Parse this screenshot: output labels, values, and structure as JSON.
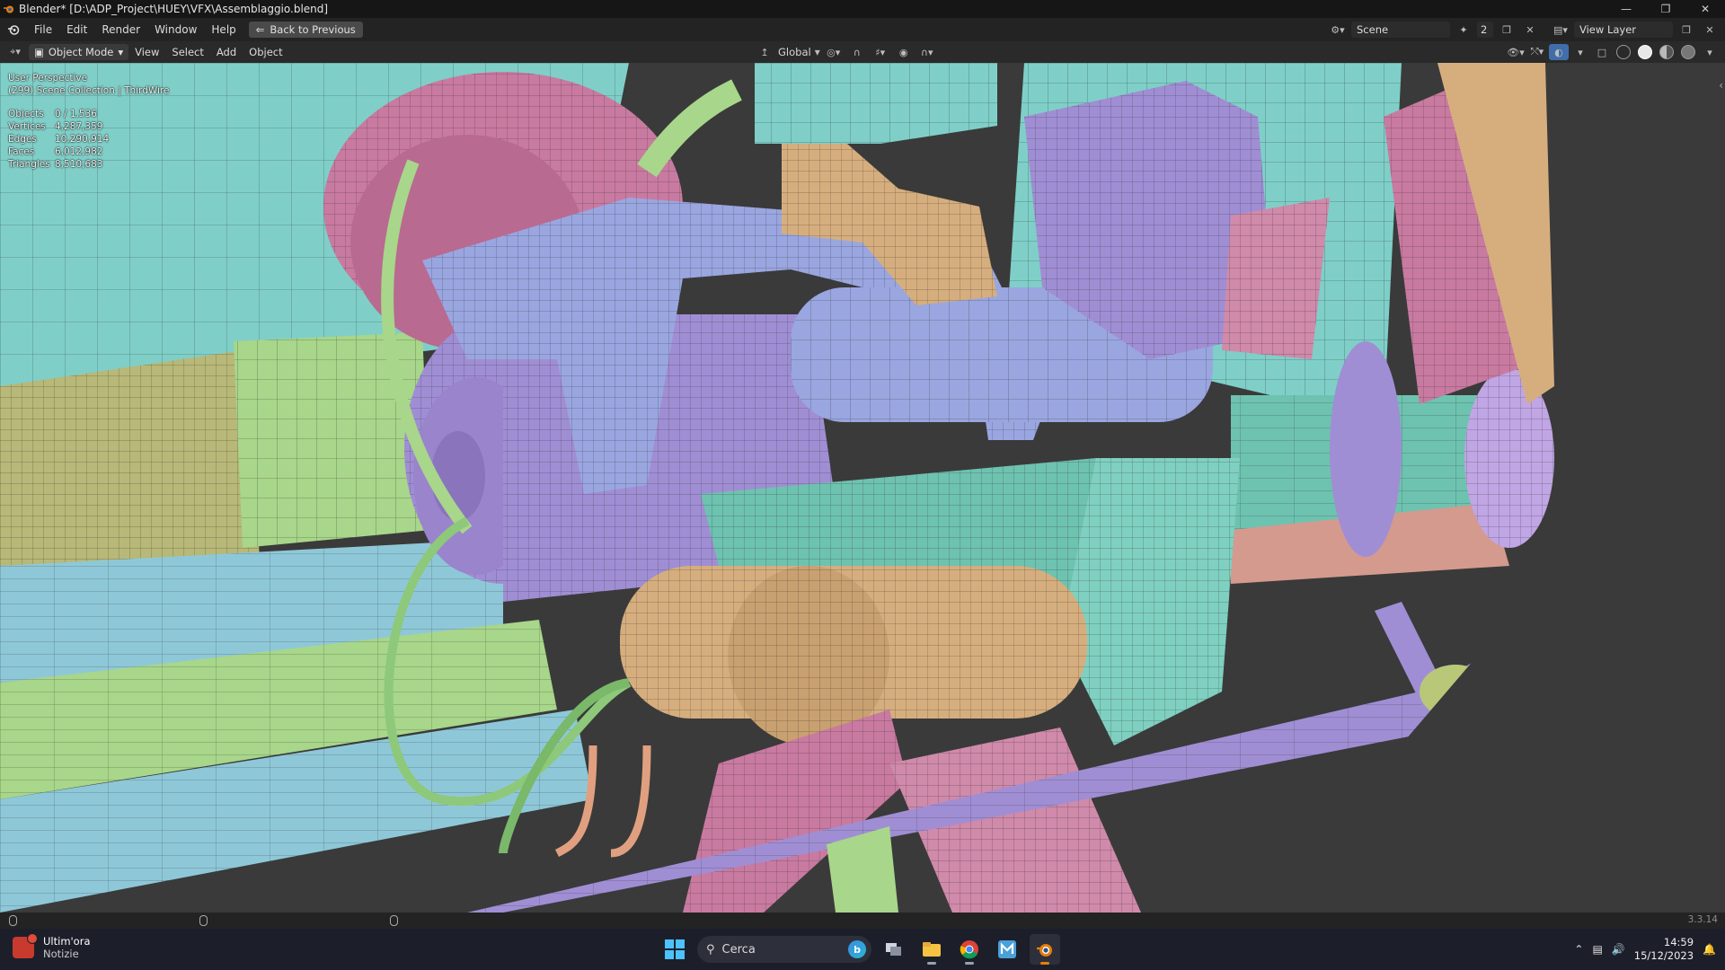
{
  "window": {
    "title": "Blender* [D:\\ADP_Project\\HUEY\\VFX\\Assemblaggio.blend]",
    "controls": [
      "minimize-icon",
      "restore-icon",
      "close-icon"
    ]
  },
  "topbar": {
    "menus": [
      "File",
      "Edit",
      "Render",
      "Window",
      "Help"
    ],
    "back_button": "Back to Previous",
    "scene_name": "Scene",
    "scene_users": "2",
    "view_layer": "View Layer"
  },
  "viewport_header": {
    "mode": "Object Mode",
    "menus": [
      "View",
      "Select",
      "Add",
      "Object"
    ],
    "transform_orientation": "Global"
  },
  "viewport": {
    "perspective": "User Perspective",
    "collection": "(299) Scene Collection | ThirdWire",
    "stats": [
      {
        "label": "Objects",
        "value": "0 / 1,536"
      },
      {
        "label": "Vertices",
        "value": "4,287,359"
      },
      {
        "label": "Edges",
        "value": "10,290,914"
      },
      {
        "label": "Faces",
        "value": "6,012,982"
      },
      {
        "label": "Triangles",
        "value": "8,510,683"
      }
    ],
    "colors": {
      "background": "#3a3a3a",
      "cyan": "#7fcfc8",
      "pink": "#c97aa0",
      "purple": "#a08ed4",
      "lavender": "#9aa6e0",
      "green": "#a8d68a",
      "tan": "#d6ae7e",
      "olive": "#b8b878",
      "teal": "#6ec2b0",
      "wire": "#2a2a2a"
    }
  },
  "statusbar": {
    "version": "3.3.14"
  },
  "taskbar": {
    "news_title": "Ultim'ora",
    "news_subtitle": "Notizie",
    "search_placeholder": "Cerca",
    "time": "14:59",
    "date": "15/12/2023"
  }
}
